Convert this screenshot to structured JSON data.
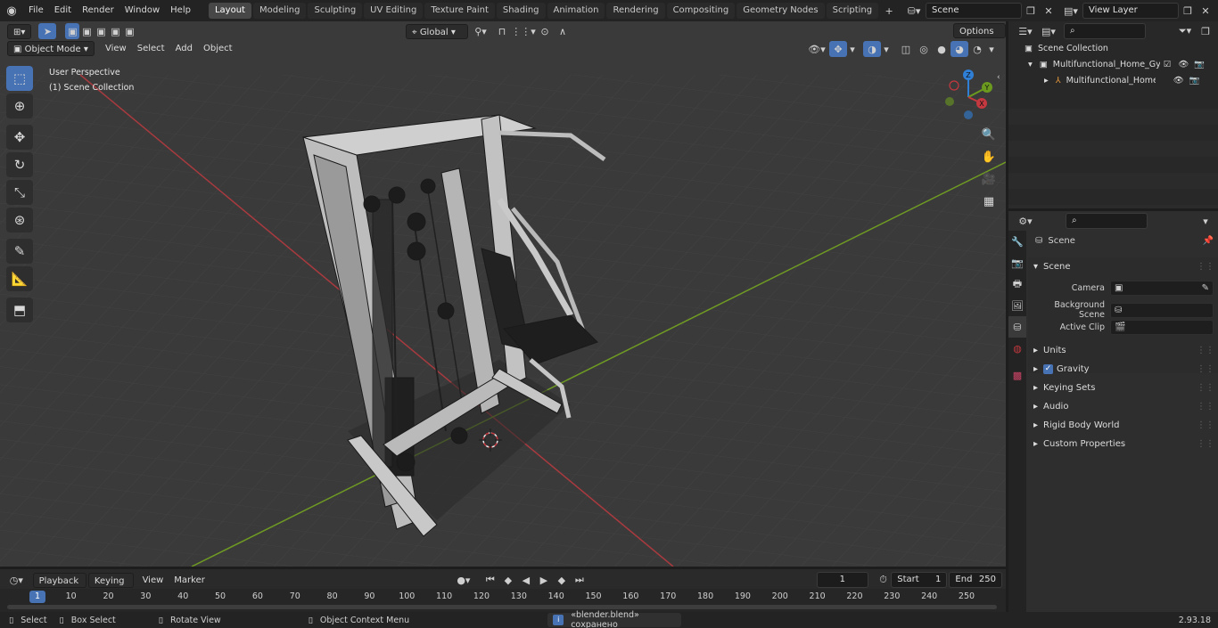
{
  "topmenu": {
    "items": [
      "File",
      "Edit",
      "Render",
      "Window",
      "Help"
    ],
    "workspaces": [
      "Layout",
      "Modeling",
      "Sculpting",
      "UV Editing",
      "Texture Paint",
      "Shading",
      "Animation",
      "Rendering",
      "Compositing",
      "Geometry Nodes",
      "Scripting"
    ],
    "active_workspace": "Layout",
    "scene_name": "Scene",
    "view_layer": "View Layer"
  },
  "viewport": {
    "mode": "Object Mode",
    "menus": [
      "View",
      "Select",
      "Add",
      "Object"
    ],
    "transform_orientation": "Global",
    "options_label": "Options",
    "perspective_label": "User Perspective",
    "collection_label": "(1) Scene Collection",
    "gizmo_axes": [
      "X",
      "Y",
      "Z"
    ]
  },
  "outliner": {
    "root": "Scene Collection",
    "items": [
      {
        "label": "Multifunctional_Home_Gym_S",
        "level": 1
      },
      {
        "label": "Multifunctional_Home_Gy",
        "level": 2
      }
    ]
  },
  "properties": {
    "context_title": "Scene",
    "section_title": "Scene",
    "fields": [
      {
        "label": "Camera"
      },
      {
        "label": "Background Scene"
      },
      {
        "label": "Active Clip"
      }
    ],
    "panels": [
      "Units",
      "Gravity",
      "Keying Sets",
      "Audio",
      "Rigid Body World",
      "Custom Properties"
    ],
    "gravity_checked": true
  },
  "timeline": {
    "menus": [
      "Playback",
      "Keying",
      "View",
      "Marker"
    ],
    "current_frame": "1",
    "start_label": "Start",
    "start_value": "1",
    "end_label": "End",
    "end_value": "250",
    "ticks": [
      "1",
      "10",
      "20",
      "30",
      "40",
      "50",
      "60",
      "70",
      "80",
      "90",
      "100",
      "110",
      "120",
      "130",
      "140",
      "150",
      "160",
      "170",
      "180",
      "190",
      "200",
      "210",
      "220",
      "230",
      "240",
      "250"
    ]
  },
  "statusbar": {
    "select": "Select",
    "box_select": "Box Select",
    "rotate_view": "Rotate View",
    "context_menu": "Object Context Menu",
    "message": "«blender.blend» сохранено",
    "version": "2.93.18"
  },
  "colors": {
    "accent": "#4772b3",
    "axis_x": "#c4383f",
    "axis_y": "#6b9a1f",
    "axis_z": "#2f7fd6"
  }
}
